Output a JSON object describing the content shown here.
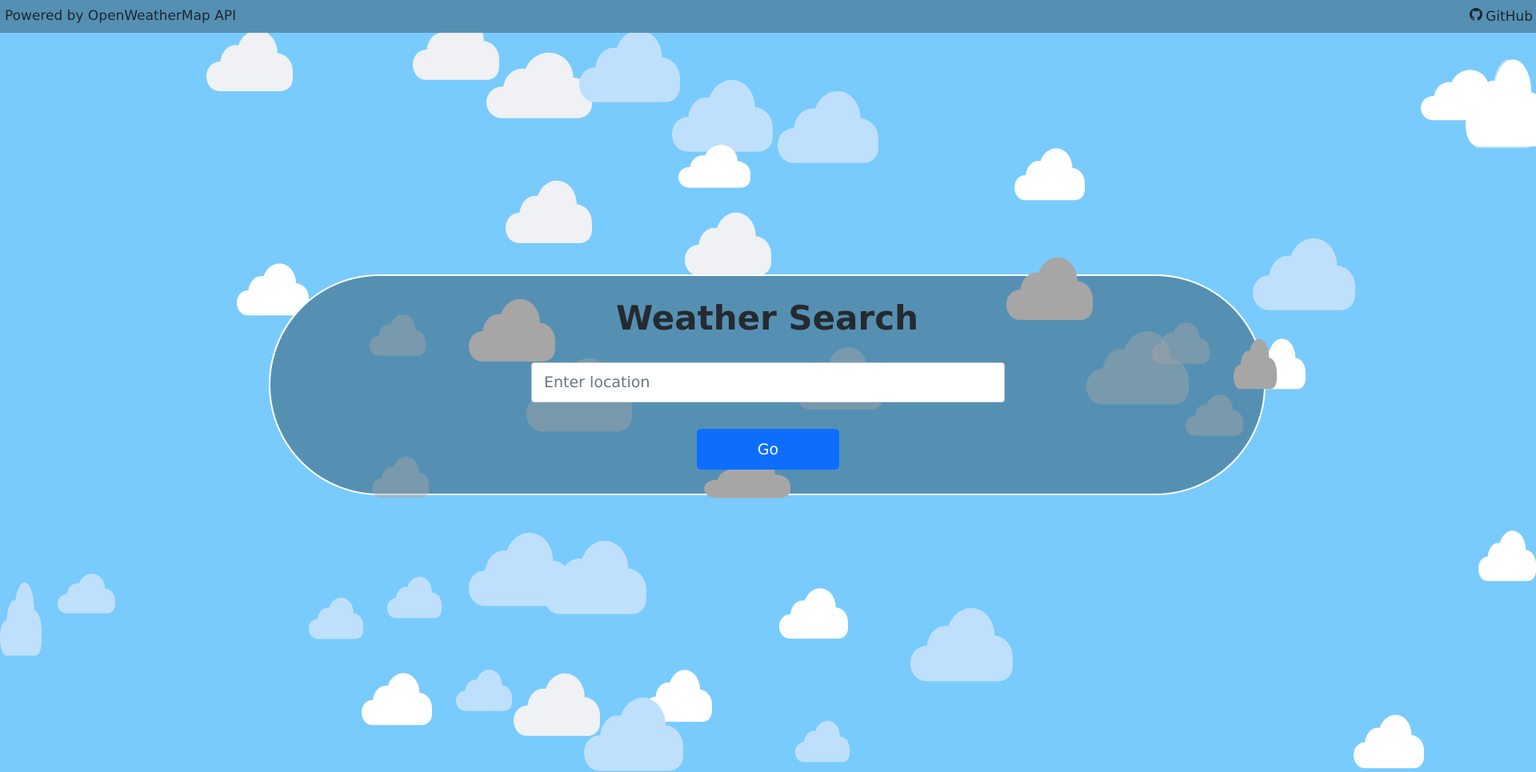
{
  "topbar": {
    "powered_by": "Powered by OpenWeatherMap API",
    "github_label": "GitHub",
    "github_icon": "github-icon"
  },
  "search": {
    "title": "Weather Search",
    "placeholder": "Enter location",
    "value": "",
    "go_label": "Go"
  },
  "colors": {
    "sky": "#79cbfd",
    "panel": "#5590b3",
    "button": "#0d6efd",
    "cloud_white": "#ffffff",
    "cloud_light_gray": "#eff1f4",
    "cloud_light_blue": "#bfe0fc",
    "cloud_gray": "#a6a6a6"
  },
  "background_icon": "cloud-icon"
}
